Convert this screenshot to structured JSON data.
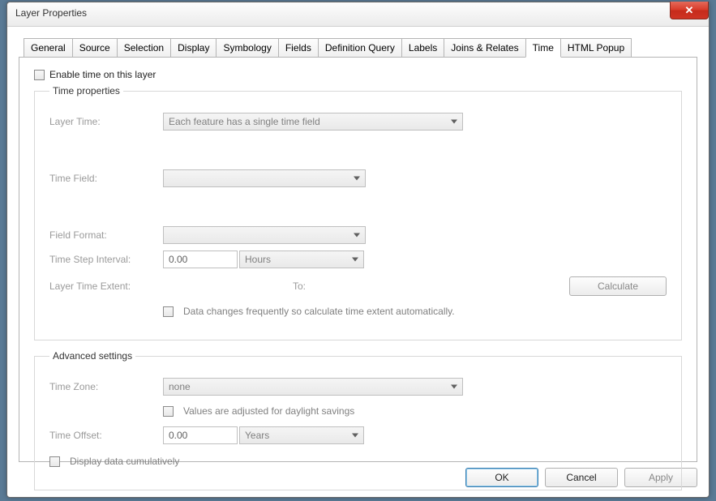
{
  "window": {
    "title": "Layer Properties"
  },
  "tabs": {
    "items": [
      "General",
      "Source",
      "Selection",
      "Display",
      "Symbology",
      "Fields",
      "Definition Query",
      "Labels",
      "Joins & Relates",
      "Time",
      "HTML Popup"
    ],
    "active": "Time"
  },
  "enable_checkbox": {
    "label": "Enable time on this layer",
    "checked": false
  },
  "time_props": {
    "legend": "Time properties",
    "layer_time_label": "Layer Time:",
    "layer_time_value": "Each feature has a single time field",
    "time_field_label": "Time Field:",
    "time_field_value": "",
    "field_format_label": "Field Format:",
    "field_format_value": "",
    "step_label": "Time Step Interval:",
    "step_value": "0.00",
    "step_unit": "Hours",
    "extent_label": "Layer Time Extent:",
    "to_label": "To:",
    "calculate_label": "Calculate",
    "auto_checkbox": "Data changes frequently so calculate time extent automatically."
  },
  "advanced": {
    "legend": "Advanced settings",
    "tz_label": "Time Zone:",
    "tz_value": "none",
    "dst_checkbox": "Values are adjusted for daylight savings",
    "offset_label": "Time Offset:",
    "offset_value": "0.00",
    "offset_unit": "Years",
    "cumulative_checkbox": "Display data cumulatively"
  },
  "footer": {
    "ok": "OK",
    "cancel": "Cancel",
    "apply": "Apply"
  }
}
